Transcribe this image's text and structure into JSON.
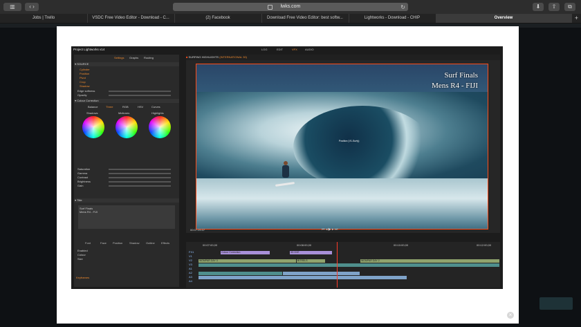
{
  "browser": {
    "url": "lwks.com",
    "tabs": [
      {
        "label": "Jobs | Trello",
        "active": false
      },
      {
        "label": "VSDC Free Video Editor - Download - C...",
        "active": false
      },
      {
        "label": "(2) Facebook",
        "active": false
      },
      {
        "label": "Download Free Video Editor: best softw...",
        "active": false
      },
      {
        "label": "Lightworks - Download - CHIP",
        "active": false
      },
      {
        "label": "Overview",
        "active": true
      }
    ],
    "new_tab": "+"
  },
  "app": {
    "title": "Project Lightworks v14",
    "modes": [
      "LOG",
      "EDIT",
      "VFX",
      "AUDIO"
    ],
    "panel_tabs": [
      "Settings",
      "Graphs",
      "Routing"
    ],
    "sections": {
      "source_header": "SOURCE",
      "source_items": [
        "Cylinder",
        "Position",
        "Pivot",
        "Crop",
        "Shadow"
      ],
      "edge": "Edge softness",
      "opacity": "Opacity",
      "cc_header": "Colour Correction",
      "cc_tabs": [
        "Balance",
        "Three",
        "RGB",
        "HSV",
        "Curves"
      ],
      "wheels": [
        "Shadows",
        "Midtones",
        "Highlights"
      ],
      "props": [
        "Saturation",
        "Gamma",
        "Contrast",
        "Brightness",
        "Gain"
      ],
      "title_header": "Title",
      "title_text_1": "Surf Finals",
      "title_text_2": "Mens R4 - FIJI",
      "font_tabs": [
        "Font",
        "Face",
        "Position",
        "Shadow",
        "Outline",
        "Effects"
      ],
      "outline_label": "Enabled",
      "colour_label": "Colour",
      "size_label": "Size",
      "keyframes": "Keyframes"
    },
    "viewer": {
      "header": "SURFING HIGHLIGHTS",
      "header_sub": "(INTERNATIONAL 30)",
      "overlay_title": "Surf Finals",
      "overlay_subtitle": "Mens R4 - FIJI",
      "transform": "Position (V1-Surfy)",
      "timecode": "00:07:25:37"
    },
    "timeline": {
      "tracks": [
        "FX1",
        "V1",
        "V2",
        "V3",
        "A1",
        "A2",
        "A3",
        "A4"
      ],
      "ruler": [
        "00:07:00,00",
        "00:08:00,00",
        "00:10:00,00",
        "00:12:00,00"
      ],
      "clips": [
        "Colour Correction",
        "3D DVE",
        "WOMPAR DAY 3",
        "BITRELS",
        "WOMPAR DAY 2"
      ]
    }
  },
  "colors": {
    "accent": "#f08a2e",
    "viewer_border": "#ff4d1a",
    "playhead": "#ff3b2a"
  }
}
